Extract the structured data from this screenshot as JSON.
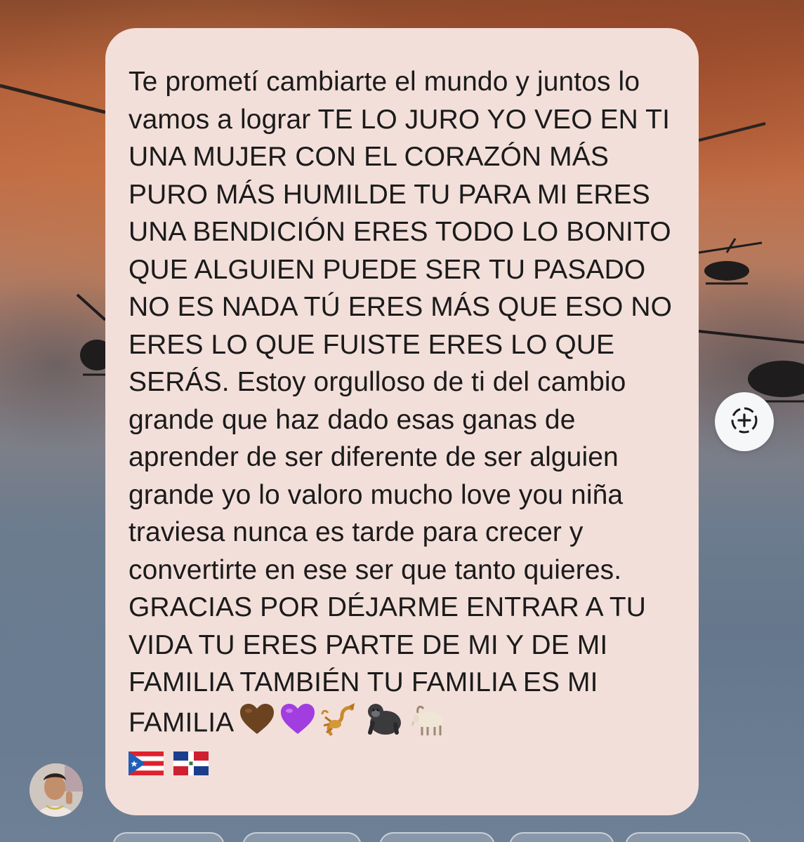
{
  "message": {
    "text": "Te prometí cambiarte el mundo y juntos lo vamos a lograr TE LO JURO YO VEO EN TI UNA MUJER CON EL CORAZÓN MÁS PURO MÁS HUMILDE TU PARA MI ERES UNA BENDICIÓN ERES TODO LO BONITO QUE ALGUIEN PUEDE SER TU PASADO NO ES NADA TÚ ERES MÁS QUE ESO NO ERES LO QUE FUISTE ERES LO QUE SERÁS. Estoy orgulloso de ti del cambio grande que haz dado esas ganas de aprender de ser diferente de ser alguien grande yo lo valoro mucho love you niña traviesa nunca es tarde para crecer y convertirte en ese ser que tanto quieres. GRACIAS POR DÉJARME ENTRAR A TU VIDA TU ERES PARTE DE MI Y DE MI FAMILIA TAMBIÉN TU FAMILIA ES MI FAMILIA",
    "emojis": [
      "brown-heart-icon",
      "purple-heart-icon",
      "scorpion-icon",
      "gorilla-icon",
      "goat-icon",
      "flag-puerto-rico-icon",
      "flag-dominican-republic-icon"
    ]
  },
  "colors": {
    "bubble": "#f3dfda",
    "text": "#1b1b1b",
    "react_button": "#f6f7f8"
  },
  "sender": {
    "avatar": "avatar-photo"
  },
  "actions": {
    "react_icon": "add-reaction-icon"
  }
}
